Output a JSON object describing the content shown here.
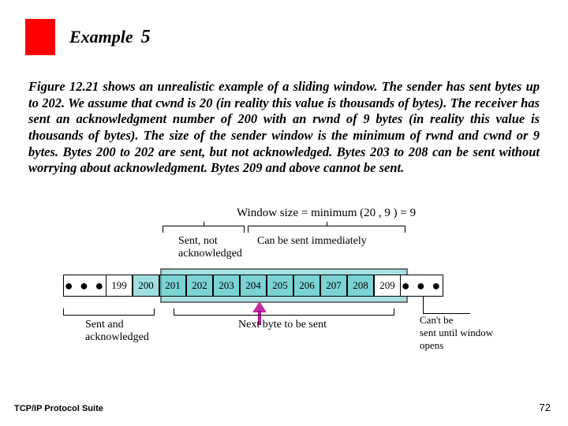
{
  "header": {
    "example_word": "Example",
    "example_number": "5"
  },
  "body": "Figure 12.21 shows an unrealistic example of a sliding window. The sender has sent bytes up to 202. We assume that cwnd is 20 (in reality this value is thousands of bytes). The receiver has sent an acknowledgment number of 200 with an rwnd of 9 bytes (in reality this value is thousands of bytes). The size of the sender window is the minimum of rwnd and cwnd or 9 bytes. Bytes 200 to 202 are sent, but not acknowledged. Bytes 203 to 208 can be sent without worrying about acknowledgment. Bytes 209 and above cannot be sent.",
  "figure": {
    "window_eq": "Window size = minimum (20 , 9 ) = 9",
    "top_labels": {
      "sent_not_ack": "Sent, not\nacknowledged",
      "can_send": "Can be sent immediately"
    },
    "dots": "● ● ●",
    "bytes": {
      "left_outside": "199",
      "window": [
        "200",
        "201",
        "202",
        "203",
        "204",
        "205",
        "206",
        "207",
        "208"
      ],
      "right_outside": "209"
    },
    "bottom_labels": {
      "sent_ack": "Sent and\nacknowledged",
      "next_byte": "Next byte to be sent",
      "cant_send": "Can't be\nsent until window\nopens"
    }
  },
  "footer": {
    "left": "TCP/IP Protocol Suite",
    "page": "72"
  }
}
